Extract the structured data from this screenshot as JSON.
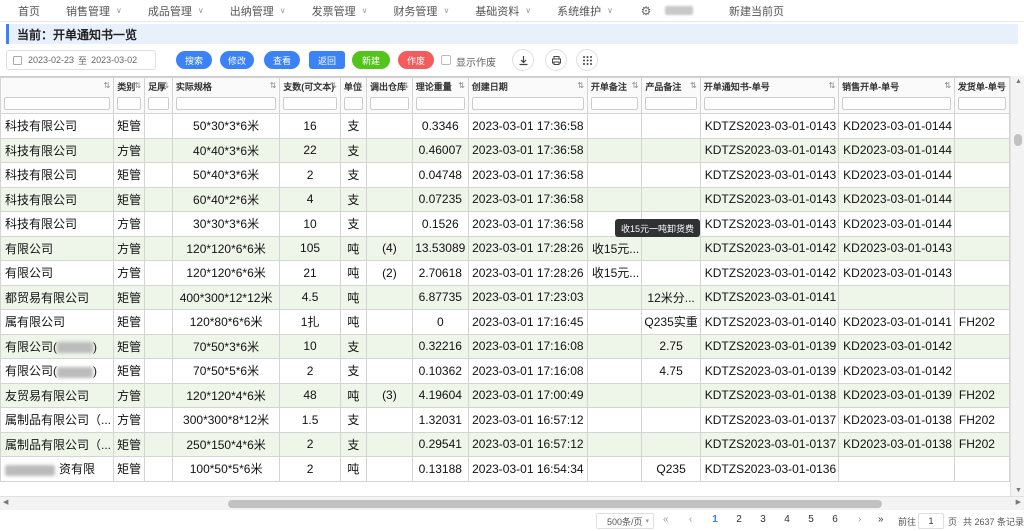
{
  "nav": {
    "items": [
      {
        "label": "首页",
        "has_menu": false
      },
      {
        "label": "销售管理",
        "has_menu": true
      },
      {
        "label": "成品管理",
        "has_menu": true
      },
      {
        "label": "出纳管理",
        "has_menu": true
      },
      {
        "label": "发票管理",
        "has_menu": true
      },
      {
        "label": "财务管理",
        "has_menu": true
      },
      {
        "label": "基础资料",
        "has_menu": true
      },
      {
        "label": "系统维护",
        "has_menu": true
      }
    ],
    "settings_icon": "gear-icon",
    "new_page_label": "新建当前页"
  },
  "breadcrumb": {
    "text": "当前：开单通知书一览"
  },
  "toolbar": {
    "date_from": "2023-02-23",
    "date_sep": "至",
    "date_to": "2023-03-02",
    "search_label": "搜索",
    "edit_label": "修改",
    "view_label": "查看",
    "back_label": "返回",
    "new_label": "新建",
    "void_label": "作废",
    "show_void_label": "显示作废",
    "download_icon": "download-icon",
    "print_icon": "print-icon",
    "grid_icon": "grid-icon"
  },
  "colors": {
    "primary": "#3b82f6",
    "green": "#52c41a",
    "red": "#f25c5c",
    "row_alt": "#eef5e9"
  },
  "table": {
    "columns": [
      {
        "key": "company",
        "label": ""
      },
      {
        "key": "category",
        "label": "类别"
      },
      {
        "key": "thickness",
        "label": "足厚"
      },
      {
        "key": "spec",
        "label": "实际规格"
      },
      {
        "key": "count",
        "label": "支数(可文本)"
      },
      {
        "key": "unit",
        "label": "单位"
      },
      {
        "key": "warehouse",
        "label": "调出仓库"
      },
      {
        "key": "weight",
        "label": "理论重量"
      },
      {
        "key": "created",
        "label": "创建日期"
      },
      {
        "key": "order_note",
        "label": "开单备注"
      },
      {
        "key": "product_note",
        "label": "产品备注"
      },
      {
        "key": "notice_no",
        "label": "开单通知书-单号"
      },
      {
        "key": "sales_no",
        "label": "销售开单-单号"
      },
      {
        "key": "ship_no",
        "label": "发货单-单号"
      }
    ],
    "rows": [
      {
        "company": "科技有限公司",
        "category": "矩管",
        "thickness": "",
        "spec": "50*30*3*6米",
        "count": "16",
        "unit": "支",
        "warehouse": "",
        "weight": "0.3346",
        "created": "2023-03-01 17:36:58",
        "order_note": "",
        "product_note": "",
        "notice_no": "KDTZS2023-03-01-0143",
        "sales_no": "KD2023-03-01-0144",
        "ship_no": ""
      },
      {
        "company": "科技有限公司",
        "category": "方管",
        "thickness": "",
        "spec": "40*40*3*6米",
        "count": "22",
        "unit": "支",
        "warehouse": "",
        "weight": "0.46007",
        "created": "2023-03-01 17:36:58",
        "order_note": "",
        "product_note": "",
        "notice_no": "KDTZS2023-03-01-0143",
        "sales_no": "KD2023-03-01-0144",
        "ship_no": ""
      },
      {
        "company": "科技有限公司",
        "category": "矩管",
        "thickness": "",
        "spec": "50*40*3*6米",
        "count": "2",
        "unit": "支",
        "warehouse": "",
        "weight": "0.04748",
        "created": "2023-03-01 17:36:58",
        "order_note": "",
        "product_note": "",
        "notice_no": "KDTZS2023-03-01-0143",
        "sales_no": "KD2023-03-01-0144",
        "ship_no": ""
      },
      {
        "company": "科技有限公司",
        "category": "矩管",
        "thickness": "",
        "spec": "60*40*2*6米",
        "count": "4",
        "unit": "支",
        "warehouse": "",
        "weight": "0.07235",
        "created": "2023-03-01 17:36:58",
        "order_note": "",
        "product_note": "",
        "notice_no": "KDTZS2023-03-01-0143",
        "sales_no": "KD2023-03-01-0144",
        "ship_no": ""
      },
      {
        "company": "科技有限公司",
        "category": "方管",
        "thickness": "",
        "spec": "30*30*3*6米",
        "count": "10",
        "unit": "支",
        "warehouse": "",
        "weight": "0.1526",
        "created": "2023-03-01 17:36:58",
        "order_note": "",
        "product_note": "",
        "notice_no": "KDTZS2023-03-01-0143",
        "sales_no": "KD2023-03-01-0144",
        "ship_no": ""
      },
      {
        "company": "有限公司",
        "category": "方管",
        "thickness": "",
        "spec": "120*120*6*6米",
        "count": "105",
        "unit": "吨",
        "warehouse": "(4)",
        "weight": "13.53089",
        "created": "2023-03-01 17:28:26",
        "order_note": "收15元...",
        "product_note": "",
        "notice_no": "KDTZS2023-03-01-0142",
        "sales_no": "KD2023-03-01-0143",
        "ship_no": ""
      },
      {
        "company": "有限公司",
        "category": "方管",
        "thickness": "",
        "spec": "120*120*6*6米",
        "count": "21",
        "unit": "吨",
        "warehouse": "(2)",
        "weight": "2.70618",
        "created": "2023-03-01 17:28:26",
        "order_note": "收15元...",
        "product_note": "",
        "notice_no": "KDTZS2023-03-01-0142",
        "sales_no": "KD2023-03-01-0143",
        "ship_no": ""
      },
      {
        "company": "都贸易有限公司",
        "category": "矩管",
        "thickness": "",
        "spec": "400*300*12*12米",
        "count": "4.5",
        "unit": "吨",
        "warehouse": "",
        "weight": "6.87735",
        "created": "2023-03-01 17:23:03",
        "order_note": "",
        "product_note": "12米分...",
        "notice_no": "KDTZS2023-03-01-0141",
        "sales_no": "",
        "ship_no": ""
      },
      {
        "company": "属有限公司",
        "category": "矩管",
        "thickness": "",
        "spec": "120*80*6*6米",
        "count": "1扎",
        "unit": "吨",
        "warehouse": "",
        "weight": "0",
        "created": "2023-03-01 17:16:45",
        "order_note": "",
        "product_note": "Q235实重",
        "notice_no": "KDTZS2023-03-01-0140",
        "sales_no": "KD2023-03-01-0141",
        "ship_no": "FH202"
      },
      {
        "company": "有限公司(",
        "category": "矩管",
        "thickness": "",
        "spec": "70*50*3*6米",
        "count": "10",
        "unit": "支",
        "warehouse": "",
        "weight": "0.32216",
        "created": "2023-03-01 17:16:08",
        "order_note": "",
        "product_note": "2.75",
        "notice_no": "KDTZS2023-03-01-0139",
        "sales_no": "KD2023-03-01-0142",
        "ship_no": ""
      },
      {
        "company": "有限公司(",
        "category": "矩管",
        "thickness": "",
        "spec": "70*50*5*6米",
        "count": "2",
        "unit": "支",
        "warehouse": "",
        "weight": "0.10362",
        "created": "2023-03-01 17:16:08",
        "order_note": "",
        "product_note": "4.75",
        "notice_no": "KDTZS2023-03-01-0139",
        "sales_no": "KD2023-03-01-0142",
        "ship_no": ""
      },
      {
        "company": "友贸易有限公司",
        "category": "方管",
        "thickness": "",
        "spec": "120*120*4*6米",
        "count": "48",
        "unit": "吨",
        "warehouse": "(3)",
        "weight": "4.19604",
        "created": "2023-03-01 17:00:49",
        "order_note": "",
        "product_note": "",
        "notice_no": "KDTZS2023-03-01-0138",
        "sales_no": "KD2023-03-01-0139",
        "ship_no": "FH202"
      },
      {
        "company": "属制品有限公司（...",
        "category": "方管",
        "thickness": "",
        "spec": "300*300*8*12米",
        "count": "1.5",
        "unit": "支",
        "warehouse": "",
        "weight": "1.32031",
        "created": "2023-03-01 16:57:12",
        "order_note": "",
        "product_note": "",
        "notice_no": "KDTZS2023-03-01-0137",
        "sales_no": "KD2023-03-01-0138",
        "ship_no": "FH202"
      },
      {
        "company": "属制品有限公司（...",
        "category": "矩管",
        "thickness": "",
        "spec": "250*150*4*6米",
        "count": "2",
        "unit": "支",
        "warehouse": "",
        "weight": "0.29541",
        "created": "2023-03-01 16:57:12",
        "order_note": "",
        "product_note": "",
        "notice_no": "KDTZS2023-03-01-0137",
        "sales_no": "KD2023-03-01-0138",
        "ship_no": "FH202"
      },
      {
        "company": "资有限",
        "category": "矩管",
        "thickness": "",
        "spec": "100*50*5*6米",
        "count": "2",
        "unit": "吨",
        "warehouse": "",
        "weight": "0.13188",
        "created": "2023-03-01 16:54:34",
        "order_note": "",
        "product_note": "Q235",
        "notice_no": "KDTZS2023-03-01-0136",
        "sales_no": "",
        "ship_no": ""
      }
    ]
  },
  "tooltip": {
    "text": "收15元一吨卸货费"
  },
  "pagination": {
    "page_size": "500条/页",
    "pages": [
      "1",
      "2",
      "3",
      "4",
      "5",
      "6"
    ],
    "current": "1",
    "goto_label": "前往",
    "goto_value": "1",
    "page_unit": "页",
    "total": "共 2637 条记录"
  }
}
